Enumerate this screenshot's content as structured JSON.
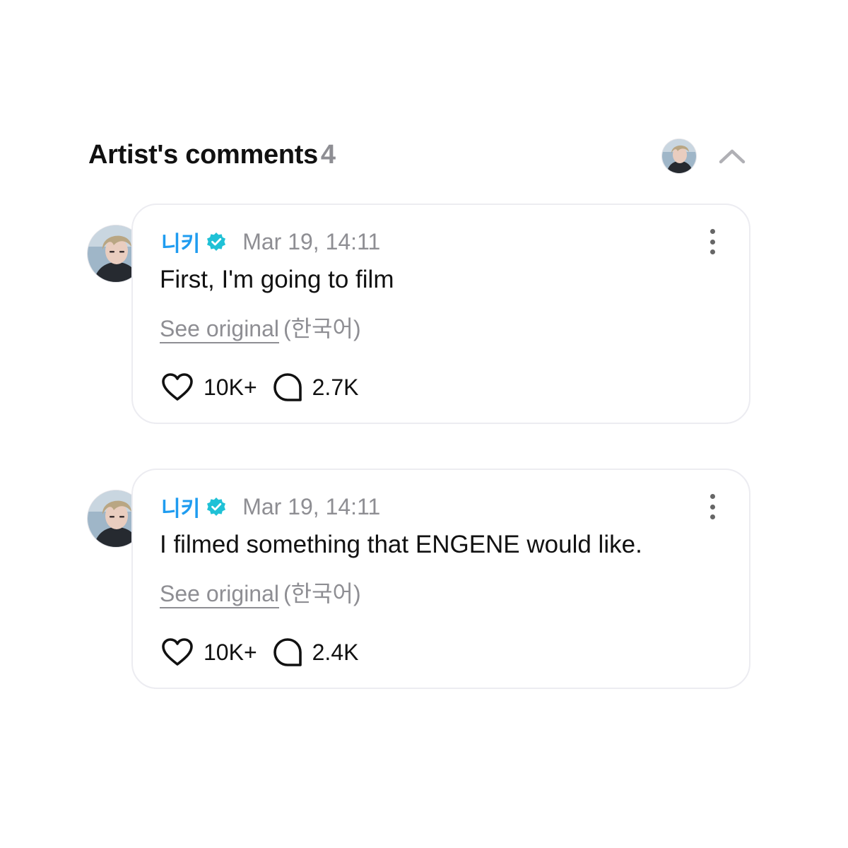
{
  "header": {
    "title": "Artist's comments",
    "count": "4"
  },
  "comments": [
    {
      "author": "니키",
      "verified": true,
      "date": "Mar 19, 14:11",
      "text": "First, I'm going to film",
      "see_original_label": "See original",
      "original_language": "(한국어)",
      "like_count": "10K+",
      "reply_count": "2.7K"
    },
    {
      "author": "니키",
      "verified": true,
      "date": "Mar 19, 14:11",
      "text": "I filmed something that ENGENE would like.",
      "see_original_label": "See original",
      "original_language": "(한국어)",
      "like_count": "10K+",
      "reply_count": "2.4K"
    }
  ],
  "colors": {
    "author": "#1f9cf0",
    "verified_badge": "#1fc1d6",
    "muted_text": "#8e8e93",
    "card_border": "#ececf1"
  },
  "icons": [
    "chevron-up-icon",
    "verified-badge-icon",
    "more-vertical-icon",
    "heart-icon",
    "comment-bubble-icon"
  ]
}
